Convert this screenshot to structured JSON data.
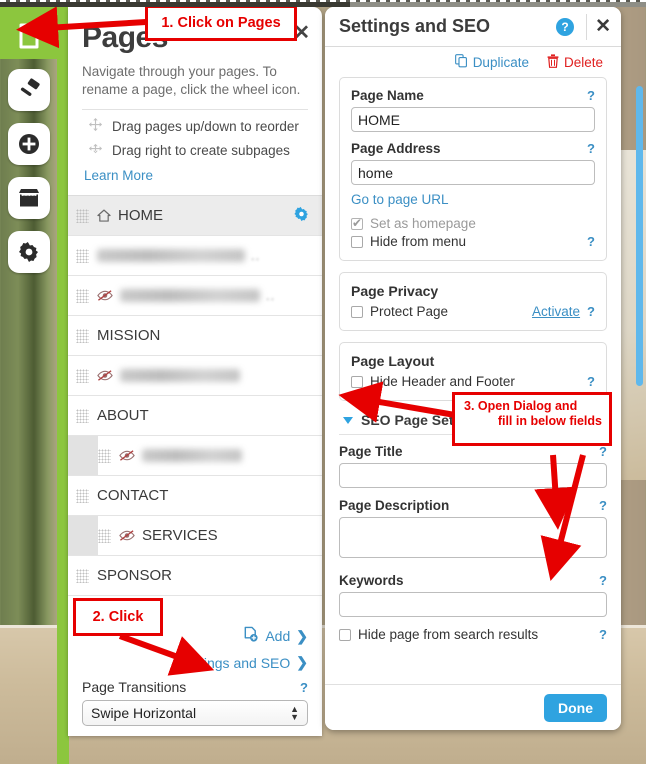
{
  "toolbar": {
    "items": [
      {
        "name": "pages-icon",
        "label": "Pages",
        "active": true
      },
      {
        "name": "design-icon",
        "label": "Design",
        "active": false
      },
      {
        "name": "add-icon",
        "label": "Add",
        "active": false
      },
      {
        "name": "store-icon",
        "label": "Store",
        "active": false
      },
      {
        "name": "settings-icon",
        "label": "Settings",
        "active": false
      }
    ]
  },
  "pages_panel": {
    "title": "Pages",
    "close_label": "✕",
    "description": "Navigate through your pages. To rename a page, click the wheel icon.",
    "hints": [
      {
        "icon": "move-vertical-icon",
        "text": "Drag pages up/down to reorder"
      },
      {
        "icon": "move-right-icon",
        "text": "Drag right to create subpages"
      }
    ],
    "learn_more": "Learn More",
    "rows": [
      {
        "label": "HOME",
        "blurred": false,
        "hidden": false,
        "home": true,
        "sub": false,
        "selected": true,
        "gear": true
      },
      {
        "label": "",
        "blurred": true,
        "hidden": false,
        "home": false,
        "sub": false,
        "selected": false,
        "gear": false,
        "blur_width": 148,
        "trailing": ".."
      },
      {
        "label": "",
        "blurred": true,
        "hidden": true,
        "home": false,
        "sub": false,
        "selected": false,
        "gear": false,
        "blur_width": 140,
        "trailing": ".."
      },
      {
        "label": "MISSION",
        "blurred": false,
        "hidden": false,
        "home": false,
        "sub": false,
        "selected": false,
        "gear": false
      },
      {
        "label": "",
        "blurred": true,
        "hidden": true,
        "home": false,
        "sub": false,
        "selected": false,
        "gear": false,
        "blur_width": 120,
        "trailing": ""
      },
      {
        "label": "ABOUT",
        "blurred": false,
        "hidden": false,
        "home": false,
        "sub": false,
        "selected": false,
        "gear": false
      },
      {
        "label": "",
        "blurred": true,
        "hidden": true,
        "home": false,
        "sub": true,
        "selected": false,
        "gear": false,
        "blur_width": 100,
        "trailing": ""
      },
      {
        "label": "CONTACT",
        "blurred": false,
        "hidden": false,
        "home": false,
        "sub": false,
        "selected": false,
        "gear": false
      },
      {
        "label": "SERVICES",
        "blurred": false,
        "hidden": true,
        "home": false,
        "sub": true,
        "selected": false,
        "gear": false
      },
      {
        "label": "SPONSOR",
        "blurred": false,
        "hidden": false,
        "home": false,
        "sub": false,
        "selected": false,
        "gear": false
      }
    ],
    "add_label": "Add",
    "settings_seo_label": "Settings and SEO",
    "chevron": "❯",
    "transitions_label": "Page Transitions",
    "transitions_value": "Swipe Horizontal",
    "help_mark": "?"
  },
  "seo_dialog": {
    "title": "Settings and SEO",
    "help_mark": "?",
    "close_label": "✕",
    "duplicate_label": "Duplicate",
    "delete_label": "Delete",
    "page_name_label": "Page Name",
    "page_name_value": "HOME",
    "page_address_label": "Page Address",
    "page_address_value": "home",
    "go_to_url_label": "Go to page URL",
    "set_homepage_label": "Set as homepage",
    "set_homepage_checked": true,
    "hide_from_menu_label": "Hide from menu",
    "hide_from_menu_checked": false,
    "privacy_title": "Page Privacy",
    "protect_page_label": "Protect Page",
    "protect_page_checked": false,
    "activate_label": "Activate",
    "layout_title": "Page Layout",
    "hide_header_footer_label": "Hide Header and Footer",
    "hide_header_footer_checked": false,
    "seo_section_label": "SEO Page Settings",
    "page_title_label": "Page Title",
    "page_title_value": "",
    "page_description_label": "Page Description",
    "page_description_value": "",
    "keywords_label": "Keywords",
    "keywords_value": "",
    "hide_from_search_label": "Hide page from search results",
    "hide_from_search_checked": false,
    "done_label": "Done"
  },
  "annotations": [
    {
      "id": 1,
      "text": "1. Click on Pages"
    },
    {
      "id": 2,
      "text": "2. Click"
    },
    {
      "id": 3,
      "line1": "3. Open Dialog and",
      "line2": "fill in below fields"
    }
  ],
  "colors": {
    "accent_green": "#8cc63e",
    "link_blue": "#3b8fc4",
    "button_blue": "#2fa3e0",
    "annotation_red": "#e60000",
    "delete_red": "#e02020"
  }
}
